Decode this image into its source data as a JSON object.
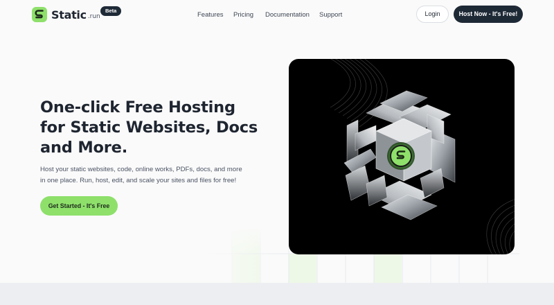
{
  "brand": {
    "name": "Static",
    "tld": ".run",
    "badge": "Beta",
    "accent_color": "#8ee06b",
    "dark_color": "#1e2936",
    "logo_icon": "static-logo-icon"
  },
  "nav": {
    "items": [
      {
        "label": "Features"
      },
      {
        "label": "Pricing"
      },
      {
        "label": "Documentation"
      },
      {
        "label": "Support"
      }
    ],
    "login_label": "Login",
    "cta_label": "Host Now - It's Free!"
  },
  "hero": {
    "title_lines": [
      "One-click Free Hosting",
      "for Static Websites, Docs",
      "and More."
    ],
    "description_lines": [
      "Host your static websites, code, online works, PDFs, docs, and more",
      "in one place. Run, host, edit, and scale your sites and files for free!"
    ],
    "cta_label": "Get Started - It's Free",
    "image_icon": "glass-cube-illustration"
  }
}
